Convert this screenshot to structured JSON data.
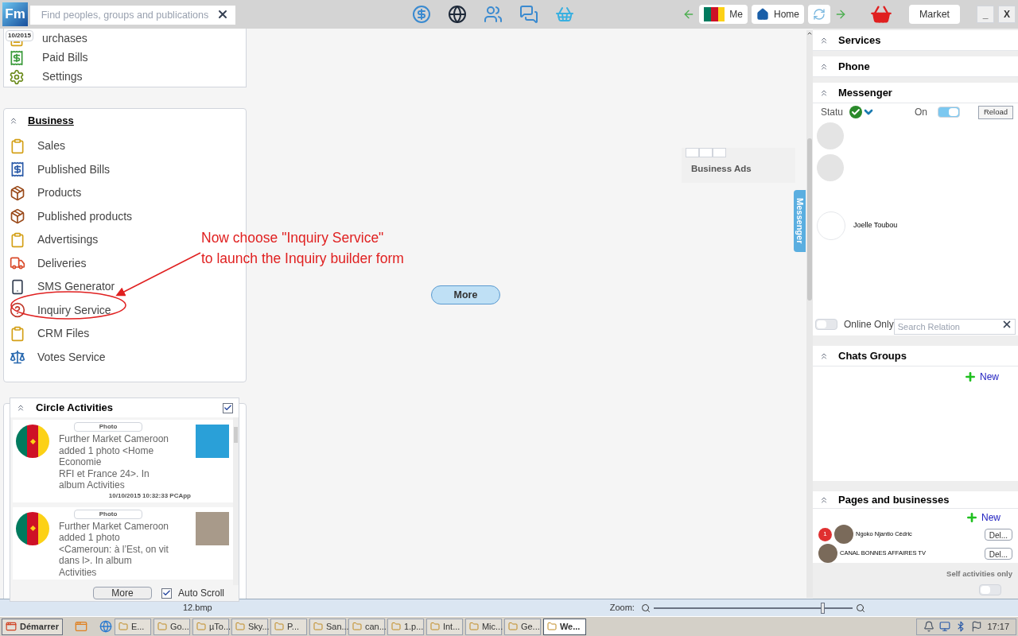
{
  "top_bar": {
    "logo": "Fm",
    "search": {
      "placeholder": "Find peoples, groups and publications"
    },
    "nav": [
      {
        "label": "Me",
        "kind": "flag"
      },
      {
        "label": "Home",
        "kind": "home"
      }
    ],
    "market": "Market",
    "window_buttons": [
      "_",
      "X"
    ]
  },
  "account_menu": {
    "badge": "10/2015",
    "items": [
      {
        "label": "urchases"
      },
      {
        "label": "Paid Bills"
      },
      {
        "label": "Settings"
      }
    ]
  },
  "business": {
    "title": "Business",
    "items": [
      {
        "label": "Sales",
        "kind": "clipboard"
      },
      {
        "label": "Published Bills",
        "kind": "bills"
      },
      {
        "label": "Products",
        "kind": "box"
      },
      {
        "label": "Published products",
        "kind": "box"
      },
      {
        "label": "Advertisings",
        "kind": "clipboard"
      },
      {
        "label": "Deliveries",
        "kind": "delivery"
      },
      {
        "label": "SMS Generator",
        "kind": "phone"
      },
      {
        "label": "Inquiry Service",
        "kind": "inquiry"
      },
      {
        "label": "CRM Files",
        "kind": "clipboard"
      },
      {
        "label": "Votes Service",
        "kind": "scale"
      }
    ]
  },
  "annotation": {
    "lines": [
      "Now choose \"Inquiry Service\"",
      "to launch the Inquiry builder form"
    ]
  },
  "center": {
    "more": "More",
    "business_ads": "Business Ads"
  },
  "messenger_tab": "Messenger",
  "right": {
    "services": "Services",
    "phone": "Phone",
    "messenger": {
      "title": "Messenger",
      "status_label": "Statu",
      "on_label": "On",
      "on": true,
      "reload": "Reload",
      "contacts": [
        {
          "name": "Joelle Toubou"
        }
      ],
      "online_only": {
        "label": "Online Only",
        "on": false
      },
      "search": {
        "placeholder": "Search Relation"
      }
    },
    "chats_groups": {
      "title": "Chats Groups",
      "new": "New"
    },
    "pages": {
      "title": "Pages and businesses",
      "new": "New",
      "items": [
        {
          "name": "Ngoko Njantio Cédric",
          "badge": "1",
          "del": "Del..."
        },
        {
          "name": "CANAL BONNES AFFAIRES TV",
          "del": "Del..."
        }
      ]
    },
    "self_activities": {
      "label": "Self activities only",
      "on": false
    }
  },
  "circle_activities": {
    "title": "Circle Activities",
    "checked": true,
    "posts": [
      {
        "tag": "Photo",
        "text": "Further Market Cameroon added 1 photo <Home Economie\nRFI et France 24>. In album Activities",
        "time": "10/10/2015 10:32:33 PCApp"
      },
      {
        "tag": "Photo",
        "text": "Further Market Cameroon added 1 photo <Cameroun: à l’Est, on vit dans l>. In album Activities"
      }
    ],
    "more": "More",
    "auto_scroll": {
      "label": "Auto Scroll",
      "checked": true
    }
  },
  "status_strip": {
    "file": "12.bmp",
    "zoom": "Zoom:",
    "zoom_slider": {
      "level": 0.85
    }
  },
  "taskbar": {
    "start": "Démarrer",
    "tasks": [
      {
        "label": "E...",
        "selected": false
      },
      {
        "label": "Go...",
        "selected": false
      },
      {
        "label": "µTo...",
        "selected": false
      },
      {
        "label": "Sky...",
        "selected": false
      },
      {
        "label": "P...",
        "selected": false
      },
      {
        "label": "San...",
        "selected": false
      },
      {
        "label": "can...",
        "selected": false
      },
      {
        "label": "1.p...",
        "selected": false
      },
      {
        "label": "Int...",
        "selected": false
      },
      {
        "label": "Mic...",
        "selected": false
      },
      {
        "label": "Ge...",
        "selected": false
      },
      {
        "label": "We...",
        "selected": true
      }
    ],
    "clock": "17:17"
  }
}
